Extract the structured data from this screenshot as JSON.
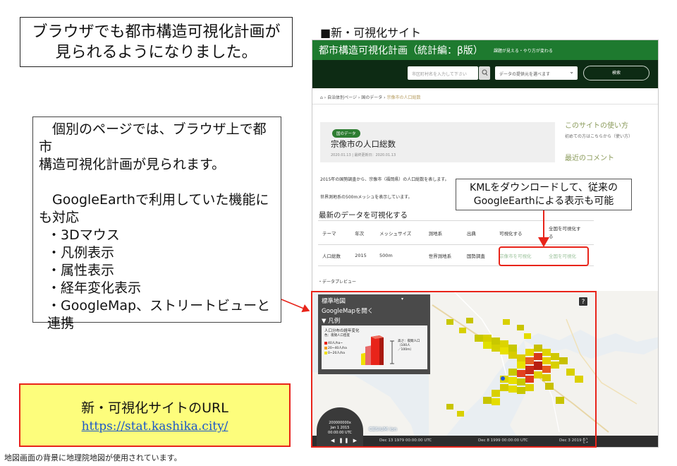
{
  "headline": {
    "line1": "ブラウザでも都市構造可視化計画が",
    "line2": "見られるようになりました。"
  },
  "site_label": "■新・可視化サイト",
  "features": {
    "intro1": "　個別のページでは、ブラウザ上で都市",
    "intro2": "構造可視化計画が見られます。",
    "intro3": "　GoogleEarthで利用していた機能に",
    "intro4": "も対応",
    "items": [
      "・3Dマウス",
      "・凡例表示",
      "・属性表示",
      "・経年変化表示",
      "・GoogleMap、ストリートビューと連携"
    ]
  },
  "url_box": {
    "title": "新・可視化サイトのURL",
    "link": "https://stat.kashika.city/"
  },
  "footnote": "地図画面の背景に地理院地図が使用されています。",
  "kml_callout": {
    "line1": "KMLをダウンロードして、従来の",
    "line2": "GoogleEarthによる表示も可能"
  },
  "screenshot": {
    "header_title": "都市構造可視化計画（統計編：β版）",
    "header_sub": "課題が見える・やり方が変わる",
    "search_placeholder": "市区町村名を入力して下さい",
    "select_placeholder": "データの提供元を選べます",
    "search_button": "検索",
    "breadcrumb": {
      "home": "⌂",
      "p1": "自治体別ページ",
      "sep": "›",
      "p2": "国のデータ",
      "current": "宗像市の人口総数"
    },
    "card": {
      "pill": "国のデータ",
      "title": "宗像市の人口総数",
      "date": "2020.01.13 | 最終更新日：2020.01.13"
    },
    "sidebar": {
      "usage": "このサイトの使い方",
      "usage_sub": "初めての方はこちらから（使い方）",
      "comments": "最近のコメント"
    },
    "desc1": "2015年の国勢調査から、宗像市（福岡県）の人口総数を表します。",
    "desc2": "世界測地系の500mメッシュを表示しています。",
    "section_title": "最新のデータを可視化する",
    "table": {
      "headers": [
        "テーマ",
        "年次",
        "メッシュサイズ",
        "測地系",
        "出典",
        "可視化する",
        "全国を可視化す\nる"
      ],
      "row": [
        "人口総数",
        "2015",
        "500m",
        "世界測地系",
        "国勢調査",
        "宗像市を可視化",
        "全国を可視化"
      ]
    },
    "preview_label": "・データプレビュー",
    "map": {
      "layer": "標準地図",
      "layer_caret": "▾",
      "gmap": "GoogleMapを開く",
      "legend_toggle": "▼ 凡例",
      "legend_title": "人口分布の経年変化",
      "legend_sub": "色：夜間人口密度",
      "legend_items": [
        "40人/ha~",
        "20~40人/ha",
        "0~20人/ha"
      ],
      "legend_height": [
        "高さ：夜間人口",
        "（100人",
        "／100m）"
      ],
      "help": "?",
      "clock_date": "200000000x",
      "clock_line2": "Jan 1 2015",
      "clock_line3": "00:00:00 UTC",
      "clock_controls": "◀ ❚❚ ▶",
      "cesium": "CESIUM ion",
      "time1": "Dec 13 1979 00:00:00 UTC",
      "time2": "Dec 8 1999 00:00:00 UTC",
      "time3": "Dec 3 2019 0",
      "fullscreen": "⛶"
    }
  },
  "colors": {
    "header_green": "#1e7a2f",
    "search_bar": "#0d2b14",
    "highlight_red": "#e8241a",
    "url_bg": "#fdfd7c",
    "link_blue": "#1a56c8"
  }
}
